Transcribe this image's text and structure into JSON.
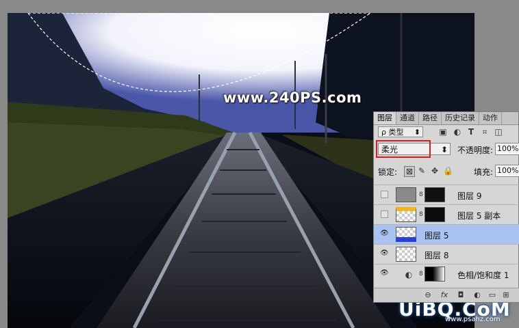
{
  "watermark": "www.240PS.com",
  "brand": {
    "main": "UiBQ.CoM",
    "sub": "www.psahz.com"
  },
  "panel": {
    "tabs": [
      "图层",
      "通道",
      "路径",
      "历史记录",
      "动作"
    ],
    "filter": {
      "label": "ρ 类型",
      "icons": [
        "image-filter-icon",
        "adjustment-filter-icon",
        "type-filter-icon",
        "shape-filter-icon",
        "smart-object-filter-icon"
      ]
    },
    "blend_mode": "柔光",
    "opacity_label": "不透明度:",
    "opacity_value": "100%",
    "lock_label": "锁定:",
    "fill_label": "填充:",
    "fill_value": "100%",
    "layers": [
      {
        "name": "图层 9",
        "visible": false,
        "selected": false
      },
      {
        "name": "图层 5 副本",
        "visible": false,
        "selected": false
      },
      {
        "name": "图层 5",
        "visible": true,
        "selected": true
      },
      {
        "name": "图层 8",
        "visible": true,
        "selected": false
      },
      {
        "name": "色相/饱和度 1",
        "visible": true,
        "selected": false
      }
    ],
    "bottom_icons": [
      "link-icon",
      "fx-icon",
      "mask-icon",
      "adjustment-icon",
      "folder-icon",
      "new-layer-icon",
      "trash-icon"
    ],
    "glyphs": {
      "eye": "👁",
      "chain": "8",
      "fx": "fx",
      "link": "⊖",
      "mask": "◘",
      "adj": "◐",
      "folder": "▭",
      "new": "⊞",
      "trash": "🗑",
      "dropdown": "⬍",
      "brush": "✎",
      "move": "✥",
      "lock": "🔒",
      "lockpx": "⊠"
    }
  }
}
